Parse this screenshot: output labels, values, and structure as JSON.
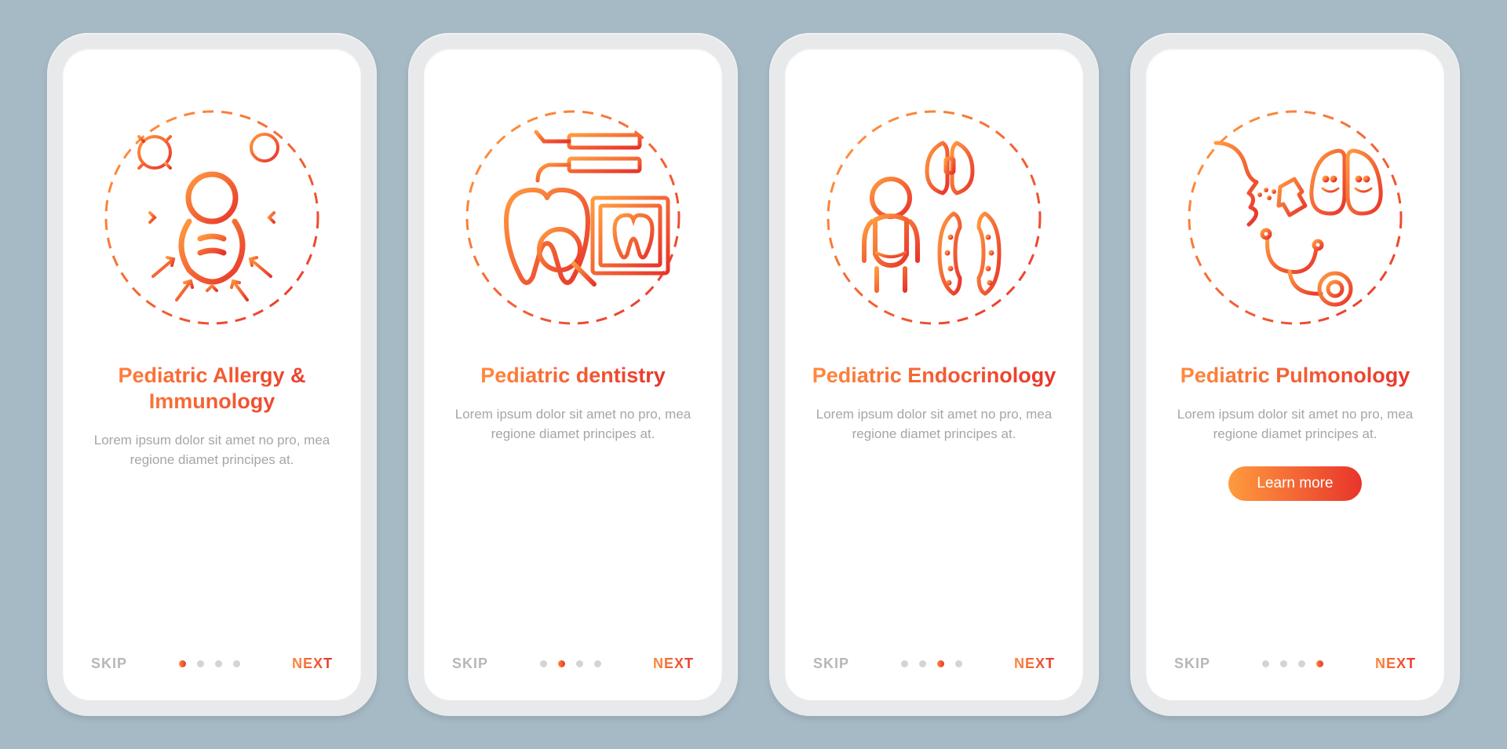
{
  "common": {
    "skip": "SKIP",
    "next": "NEXT",
    "learn_more": "Learn more",
    "desc": "Lorem ipsum dolor sit amet no pro, mea regione diamet principes at."
  },
  "screens": [
    {
      "title": "Pediatric Allergy & Immunology",
      "active_dot": 0,
      "has_cta": false,
      "icon": "allergy-immunology-icon"
    },
    {
      "title": "Pediatric dentistry",
      "active_dot": 1,
      "has_cta": false,
      "icon": "dentistry-icon"
    },
    {
      "title": "Pediatric Endocrinology",
      "active_dot": 2,
      "has_cta": false,
      "icon": "endocrinology-icon"
    },
    {
      "title": "Pediatric Pulmonology",
      "active_dot": 3,
      "has_cta": true,
      "icon": "pulmonology-icon"
    }
  ],
  "colors": {
    "grad_start": "#ff9b3f",
    "grad_end": "#e8342b",
    "muted": "#a6a6a6",
    "dot_inactive": "#d4d4d4"
  }
}
